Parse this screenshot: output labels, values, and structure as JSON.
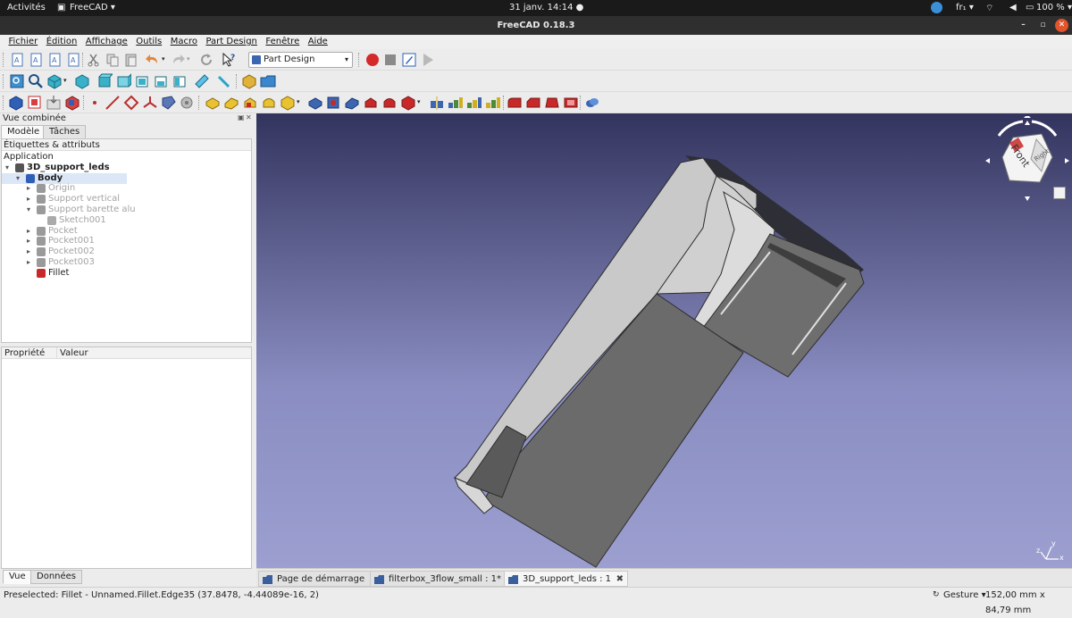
{
  "system_bar": {
    "activities": "Activités",
    "app_menu": "FreeCAD ▾",
    "datetime": "31 janv.  14:14 ●",
    "lang": "fr₁ ▾",
    "battery": "100 % ▾"
  },
  "window": {
    "title": "FreeCAD 0.18.3",
    "minimize": "–",
    "maximize": "▫",
    "close": "✕"
  },
  "menu": [
    {
      "label": "Fichier"
    },
    {
      "label": "Édition"
    },
    {
      "label": "Affichage"
    },
    {
      "label": "Outils"
    },
    {
      "label": "Macro"
    },
    {
      "label": "Part Design"
    },
    {
      "label": "Fenêtre"
    },
    {
      "label": "Aide"
    }
  ],
  "workbench": {
    "selected": "Part Design"
  },
  "combo_view": {
    "title": "Vue combinée",
    "tabs": [
      {
        "label": "Modèle"
      },
      {
        "label": "Tâches"
      }
    ],
    "labels_header": "Étiquettes & attributs",
    "tree": [
      {
        "label": "Application",
        "indent": 0,
        "style": "normal",
        "arrow": ""
      },
      {
        "label": "3D_support_leds",
        "indent": 1,
        "style": "bold",
        "arrow": "▾"
      },
      {
        "label": "Body",
        "indent": 2,
        "style": "bold",
        "arrow": "▾"
      },
      {
        "label": "Origin",
        "indent": 3,
        "style": "dim",
        "arrow": "▸"
      },
      {
        "label": "Support vertical",
        "indent": 3,
        "style": "dim",
        "arrow": "▸"
      },
      {
        "label": "Support barette alu",
        "indent": 3,
        "style": "dim",
        "arrow": "▾"
      },
      {
        "label": "Sketch001",
        "indent": 4,
        "style": "dim",
        "arrow": ""
      },
      {
        "label": "Pocket",
        "indent": 3,
        "style": "dim",
        "arrow": "▸"
      },
      {
        "label": "Pocket001",
        "indent": 3,
        "style": "dim",
        "arrow": "▸"
      },
      {
        "label": "Pocket002",
        "indent": 3,
        "style": "dim",
        "arrow": "▸"
      },
      {
        "label": "Pocket003",
        "indent": 3,
        "style": "dim",
        "arrow": "▸"
      },
      {
        "label": "Fillet",
        "indent": 3,
        "style": "normal",
        "arrow": ""
      }
    ],
    "property_header": "Propriété",
    "value_header": "Valeur",
    "bottom_tabs": [
      {
        "label": "Vue"
      },
      {
        "label": "Données"
      }
    ]
  },
  "nav_cube": {
    "face_label": "Front",
    "side_label": "Right"
  },
  "axis": {
    "x": "x",
    "y": "y",
    "z": "z"
  },
  "document_tabs": [
    {
      "label": "Page de démarrage"
    },
    {
      "label": "filterbox_3flow_small : 1*"
    },
    {
      "label": "3D_support_leds : 1"
    }
  ],
  "status": {
    "message": "Preselected: Fillet - Unnamed.Fillet.Edge35 (37.8478, -4.44089e-16, 2)",
    "nav_style": "Gesture ▾",
    "dimensions": "152,00 mm x 84,79 mm"
  },
  "colors": {
    "viewport_top": "#33345e",
    "viewport_bottom": "#9c9fd0",
    "selection": "#dbe6f7",
    "body_icon": "#2f5fb6",
    "record_red": "#d42a2a"
  }
}
